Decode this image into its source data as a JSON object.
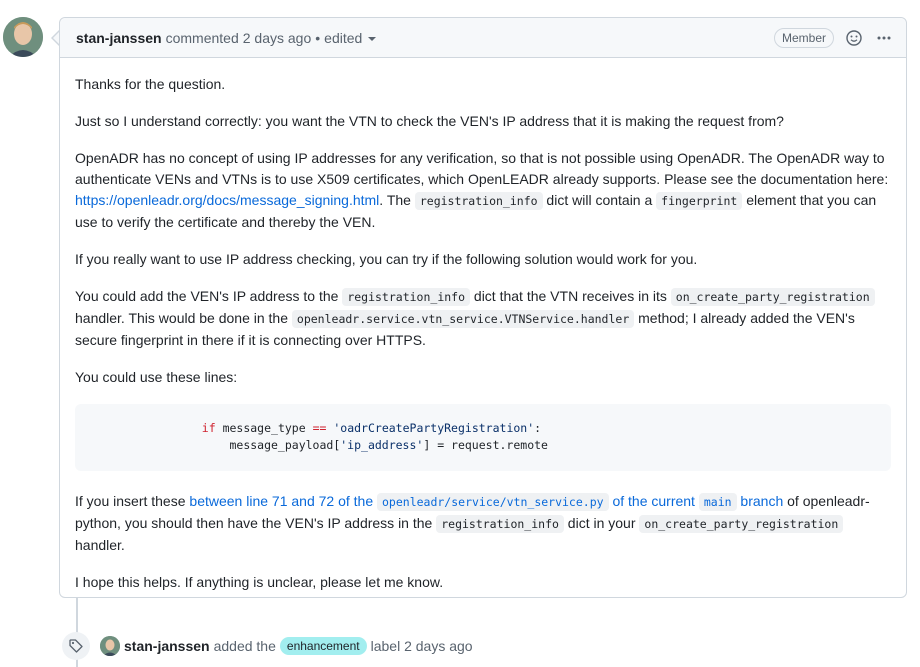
{
  "comment": {
    "author": "stan-janssen",
    "action": "commented",
    "time": "2 days ago",
    "separator": "•",
    "edited": "edited",
    "role_badge": "Member",
    "intro": "Thanks for the question.",
    "p2": "Just so I understand correctly: you want the VTN to check the VEN's IP address that it is making the request from?",
    "p3_a": "OpenADR has no concept of using IP addresses for any verification, so that is not possible using OpenADR. The OpenADR way to authenticate VENs and VTNs is to use X509 certificates, which OpenLEADR already supports. Please see the documentation here: ",
    "p3_link": "https://openleadr.org/docs/message_signing.html",
    "p3_b": ". The ",
    "p3_code1": "registration_info",
    "p3_c": " dict will contain a ",
    "p3_code2": "fingerprint",
    "p3_d": " element that you can use to verify the certificate and thereby the VEN.",
    "p4": "If you really want to use IP address checking, you can try if the following solution would work for you.",
    "p5_a": "You could add the VEN's IP address to the ",
    "p5_code1": "registration_info",
    "p5_b": " dict that the VTN receives in its ",
    "p5_code2": "on_create_party_registration",
    "p5_c": " handler. This would be done in the ",
    "p5_code3": "openleadr.service.vtn_service.VTNService.handler",
    "p5_d": " method; I already added the VEN's secure fingerprint in there if it is connecting over HTTPS.",
    "p6": "You could use these lines:",
    "code_line1_indent": "                ",
    "code_kw_if": "if",
    "code_line1_a": " message_type ",
    "code_op": "==",
    "code_str1": " 'oadrCreatePartyRegistration'",
    "code_line1_b": ":",
    "code_line2_a": "                    message_payload[",
    "code_str2": "'ip_address'",
    "code_line2_b": "] = request.remote",
    "p7_a": "If you insert these ",
    "p7_link1": "between line 71 and 72 of the ",
    "p7_link_code1": "openleadr/service/vtn_service.py",
    "p7_link2": " of the current ",
    "p7_link_code2": "main",
    "p7_link3": " branch",
    "p7_b": " of openleadr-python, you should then have the VEN's IP address in the ",
    "p7_code1": "registration_info",
    "p7_c": " dict in your ",
    "p7_code2": "on_create_party_registration",
    "p7_d": " handler.",
    "p8": "I hope this helps. If anything is unclear, please let me know."
  },
  "event": {
    "author": "stan-janssen",
    "action": "added the",
    "label": "enhancement",
    "suffix": "label 2 days ago",
    "label_color": "#a2eeef"
  },
  "icons": [
    "tag-icon",
    "smiley-icon",
    "kebab-horizontal-icon",
    "triangle-down-icon"
  ]
}
